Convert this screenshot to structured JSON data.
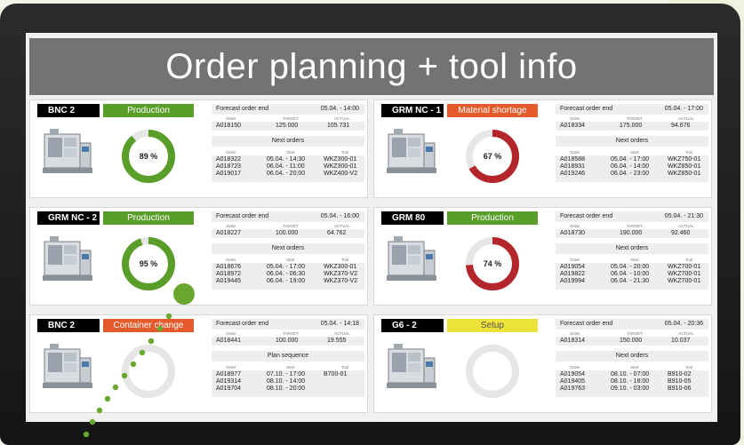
{
  "title": "Order planning + tool info",
  "cards": [
    {
      "machine": "BNC 2",
      "status": "Production",
      "status_color": "#5a9e2a",
      "gauge_label": "89 %",
      "gauge_value": 89,
      "gauge_color": "#5a9e2a",
      "forecast_label": "Forecast order end",
      "forecast_value": "05.04. - 14:00",
      "h1": "Order",
      "h2": "TARGET",
      "h3": "ACTUAL",
      "order": "A018150",
      "target": "125.000",
      "actual": "105.731",
      "section": "Next orders",
      "c1": "Order",
      "c2": "Start",
      "c3": "Tool",
      "col1": "A018322\nA018723\nA019017",
      "col2": "05.04. - 14:30\n06.04. - 11:00\n06.04. - 20:00",
      "col3": "WKZ300-01\nWKZ300-01\nWKZ400-V2"
    },
    {
      "machine": "GRM NC - 1",
      "status": "Material shortage",
      "status_color": "#e55a2a",
      "gauge_label": "67 %",
      "gauge_value": 67,
      "gauge_color": "#b3262c",
      "forecast_label": "Forecast order end",
      "forecast_value": "05.04. - 17:00",
      "h1": "Order",
      "h2": "TARGET",
      "h3": "ACTUAL",
      "order": "A018334",
      "target": "175.000",
      "actual": "94.676",
      "section": "Next orders",
      "c1": "Order",
      "c2": "Start",
      "c3": "Tool",
      "col1": "A018588\nA018931\nA019246",
      "col2": "05.04. - 17:00\n06.04. - 14:00\n06.04. - 23:00",
      "col3": "WKZ750-01\nWKZ850-01\nWKZ850-01"
    },
    {
      "machine": "GRM NC - 2",
      "status": "Production",
      "status_color": "#5a9e2a",
      "gauge_label": "95 %",
      "gauge_value": 95,
      "gauge_color": "#5a9e2a",
      "forecast_label": "Forecast order end",
      "forecast_value": "05.04. - 16:00",
      "h1": "Order",
      "h2": "TARGET",
      "h3": "ACTUAL",
      "order": "A018227",
      "target": "100.000",
      "actual": "64.762",
      "section": "Next orders",
      "c1": "Order",
      "c2": "Start",
      "c3": "Tool",
      "col1": "A018676\nA018972\nA019445",
      "col2": "05.04. - 17:00\n06.04. - 06:30\n06.04. - 19:00",
      "col3": "WKZ300-01\nWKZ370-V2\nWKZ370-V2"
    },
    {
      "machine": "GRM 80",
      "status": "Production",
      "status_color": "#5a9e2a",
      "gauge_label": "74 %",
      "gauge_value": 74,
      "gauge_color": "#b3262c",
      "forecast_label": "Forecast order end",
      "forecast_value": "05.04. - 21:30",
      "h1": "Order",
      "h2": "TARGET",
      "h3": "ACTUAL",
      "order": "A018730",
      "target": "190.000",
      "actual": "92.460",
      "section": "Next orders",
      "c1": "Order",
      "c2": "Start",
      "c3": "Tool",
      "col1": "A019054\nA019822\nA019994",
      "col2": "05.04. - 20:00\n06.04. - 10:00\n06.04. - 21:30",
      "col3": "WKZ700-01\nWKZ700-01\nWKZ700-01"
    },
    {
      "machine": "BNC 2",
      "status": "Container change",
      "status_color": "#e55a2a",
      "gauge_label": "",
      "gauge_value": 0,
      "gauge_color": "#e6e6e6",
      "forecast_label": "Forecast order end",
      "forecast_value": "05.04. - 14:18",
      "h1": "Order",
      "h2": "TARGET",
      "h3": "ACTUAL",
      "order": "A018441",
      "target": "100.000",
      "actual": "19.555",
      "section": "Plan sequence",
      "c1": "Order",
      "c2": "Start",
      "c3": "Tool",
      "col1": "A018977\nA019314\nA019704",
      "col2": "07.10. - 17:00\n08.10. - 14:00\n08.10. - 20:00",
      "col3": "B700-01\n\n"
    },
    {
      "machine": "G6 - 2",
      "status": "Setup",
      "status_color": "#ece23a",
      "gauge_label": "",
      "gauge_value": 0,
      "gauge_color": "#e6e6e6",
      "forecast_label": "Forecast order end",
      "forecast_value": "05.04. - 20:36",
      "h1": "Order",
      "h2": "TARGET",
      "h3": "ACTUAL",
      "order": "A018314",
      "target": "150.000",
      "actual": "10.037",
      "section": "Next orders",
      "c1": "Order",
      "c2": "Start",
      "c3": "Tool",
      "col1": "A019054\nA019405\nA019763",
      "col2": "08.10. - 07:00\n08.10. - 18:00\n09.10. - 03:00",
      "col3": "B910-02\nB910-05\nB910-06"
    }
  ]
}
